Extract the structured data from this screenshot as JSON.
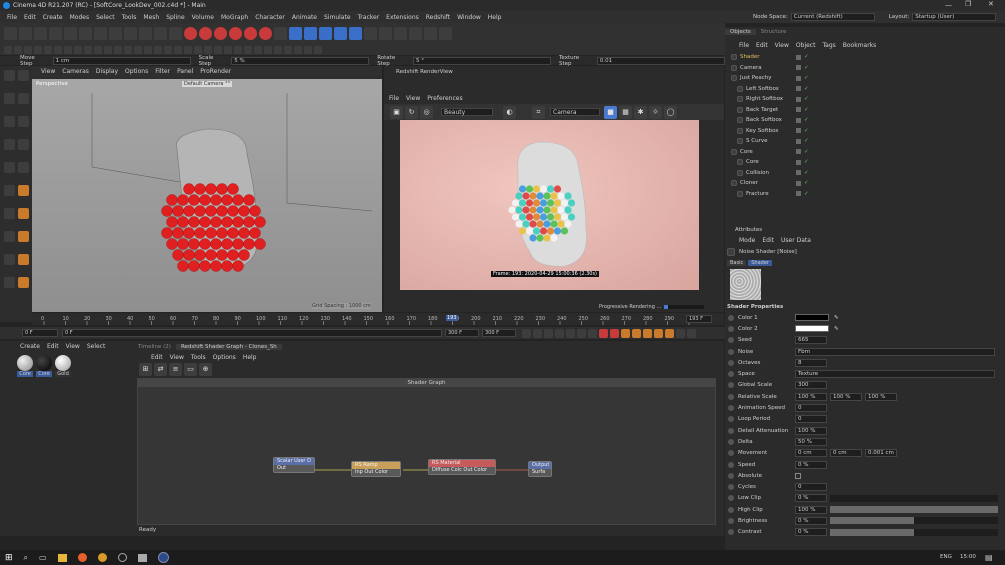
{
  "window": {
    "title": "Cinema 4D R21.207 (RC) - [SoftCore_LookDev_002.c4d *] - Main"
  },
  "menubar": [
    "File",
    "Edit",
    "Create",
    "Modes",
    "Select",
    "Tools",
    "Mesh",
    "Spline",
    "Volume",
    "MoGraph",
    "Character",
    "Animate",
    "Simulate",
    "Tracker",
    "Extensions",
    "Redshift",
    "Window",
    "Help"
  ],
  "node_space": {
    "label": "Node Space:",
    "value": "Current (Redshift)"
  },
  "layout": {
    "label": "Layout:",
    "value": "Startup (User)"
  },
  "steps": {
    "move_label": "Move Step",
    "move_value": "1 cm",
    "scale_label": "Scale Step",
    "scale_value": "5 %",
    "rotate_label": "Rotate Step",
    "rotate_value": "5 °",
    "texture_label": "Texture Step",
    "texture_value": "0.01"
  },
  "viewport": {
    "menu": [
      "View",
      "Cameras",
      "Display",
      "Options",
      "Filter",
      "Panel",
      "ProRender"
    ],
    "name": "Perspective",
    "camera": "Default Camera °°",
    "grid": "Grid Spacing : 1000 cm"
  },
  "renderview": {
    "title": "Redshift RenderView",
    "menu": [
      "File",
      "View",
      "Preferences"
    ],
    "aov": "Beauty",
    "camera": "Camera",
    "frame_info": "Frame: 193: 2020-04-29 15:00:36 (2.30s)",
    "progress_label": "Progressive Rendering ..."
  },
  "timeline": {
    "ticks": [
      "0",
      "10",
      "20",
      "30",
      "40",
      "50",
      "60",
      "70",
      "80",
      "90",
      "100",
      "110",
      "120",
      "130",
      "140",
      "150",
      "160",
      "170",
      "180",
      "190",
      "200",
      "210",
      "220",
      "230",
      "240",
      "250",
      "260",
      "270",
      "280",
      "290",
      "300"
    ],
    "current": "193",
    "end_label": "193 F",
    "start_field": "0 F",
    "min_field": "0 F",
    "max_field": "300 F",
    "max_field2": "300 F"
  },
  "materials": {
    "menu": [
      "Create",
      "Edit",
      "View",
      "Select"
    ],
    "items": [
      {
        "label": "Core"
      },
      {
        "label": "Core"
      },
      {
        "label": "Gold"
      }
    ]
  },
  "shader_graph": {
    "tabs": [
      "Timeline (2)",
      "Redshift Shader Graph - Clones_Sh"
    ],
    "menu": [
      "Edit",
      "View",
      "Tools",
      "Options",
      "Help"
    ],
    "title": "Shader Graph",
    "nodes": [
      {
        "title": "Scalar User D",
        "port": "Out",
        "color": "#5a6fa8"
      },
      {
        "title": "RS Ramp",
        "port": "Inp Out Color",
        "color": "#c9a05a"
      },
      {
        "title": "RS Material",
        "port": "Diffuse Colc Out Color",
        "color": "#c75a5a"
      },
      {
        "title": "Output",
        "port": "Surfa",
        "color": "#5a6fa8"
      }
    ],
    "status": "Ready"
  },
  "objects_panel": {
    "tabs": [
      "Objects",
      "Structure"
    ],
    "menu": [
      "File",
      "Edit",
      "View",
      "Object",
      "Tags",
      "Bookmarks"
    ],
    "tree": [
      {
        "name": "Shader",
        "indent": 0,
        "color": "#e0c060"
      },
      {
        "name": "Camera",
        "indent": 0,
        "color": "#cfcfcf"
      },
      {
        "name": "Just Peachy",
        "indent": 0,
        "color": "#cfcfcf"
      },
      {
        "name": "Left Softbox",
        "indent": 1,
        "color": "#cfcfcf"
      },
      {
        "name": "Right Softbox",
        "indent": 1,
        "color": "#cfcfcf"
      },
      {
        "name": "Back Target",
        "indent": 1,
        "color": "#cfcfcf"
      },
      {
        "name": "Back Softbox",
        "indent": 1,
        "color": "#cfcfcf"
      },
      {
        "name": "Key Softbox",
        "indent": 1,
        "color": "#cfcfcf"
      },
      {
        "name": "S Curve",
        "indent": 1,
        "color": "#cfcfcf"
      },
      {
        "name": "Core",
        "indent": 0,
        "color": "#cfcfcf"
      },
      {
        "name": "Core",
        "indent": 1,
        "color": "#cfcfcf"
      },
      {
        "name": "Collision",
        "indent": 1,
        "color": "#cfcfcf"
      },
      {
        "name": "Cloner",
        "indent": 0,
        "color": "#cfcfcf"
      },
      {
        "name": "Fracture",
        "indent": 1,
        "color": "#cfcfcf"
      }
    ]
  },
  "attributes": {
    "title": "Attributes",
    "menu": [
      "Mode",
      "Edit",
      "User Data"
    ],
    "shader_name": "Noise Shader [Noise]",
    "tabs": [
      "Basic",
      "Shader"
    ],
    "section": "Shader Properties",
    "props": [
      {
        "label": "Color 1",
        "value": "",
        "swatch": "#000000"
      },
      {
        "label": "Color 2",
        "value": "",
        "swatch": "#ffffff"
      },
      {
        "label": "Seed",
        "value": "665"
      },
      {
        "label": "Noise",
        "value": "Fbm",
        "dropdown": true
      },
      {
        "label": "Octaves",
        "value": "8"
      },
      {
        "label": "Space",
        "value": "Texture",
        "dropdown": true
      },
      {
        "label": "Global Scale",
        "value": "300"
      },
      {
        "label": "Relative Scale",
        "value": "100 %",
        "extra": [
          "100 %",
          "100 %"
        ]
      },
      {
        "label": "Animation Speed",
        "value": "0"
      },
      {
        "label": "Loop Period",
        "value": "0"
      },
      {
        "label": "Detail Attenuation",
        "value": "100 %"
      },
      {
        "label": "Delta",
        "value": "50 %"
      },
      {
        "label": "Movement",
        "value": "0 cm",
        "extra": [
          "0 cm",
          "0.001 cm"
        ]
      },
      {
        "label": "Speed",
        "value": "0 %"
      },
      {
        "label": "Absolute",
        "value": "",
        "checkbox": true
      },
      {
        "label": "Cycles",
        "value": "0"
      },
      {
        "label": "Low Clip",
        "value": "0 %",
        "slider": 0.0
      },
      {
        "label": "High Clip",
        "value": "100 %",
        "slider": 1.0
      },
      {
        "label": "Brightness",
        "value": "0 %",
        "slider": 0.5
      },
      {
        "label": "Contrast",
        "value": "0 %",
        "slider": 0.5
      }
    ]
  },
  "taskbar": {
    "lang": "ENG",
    "time": "15:00"
  }
}
